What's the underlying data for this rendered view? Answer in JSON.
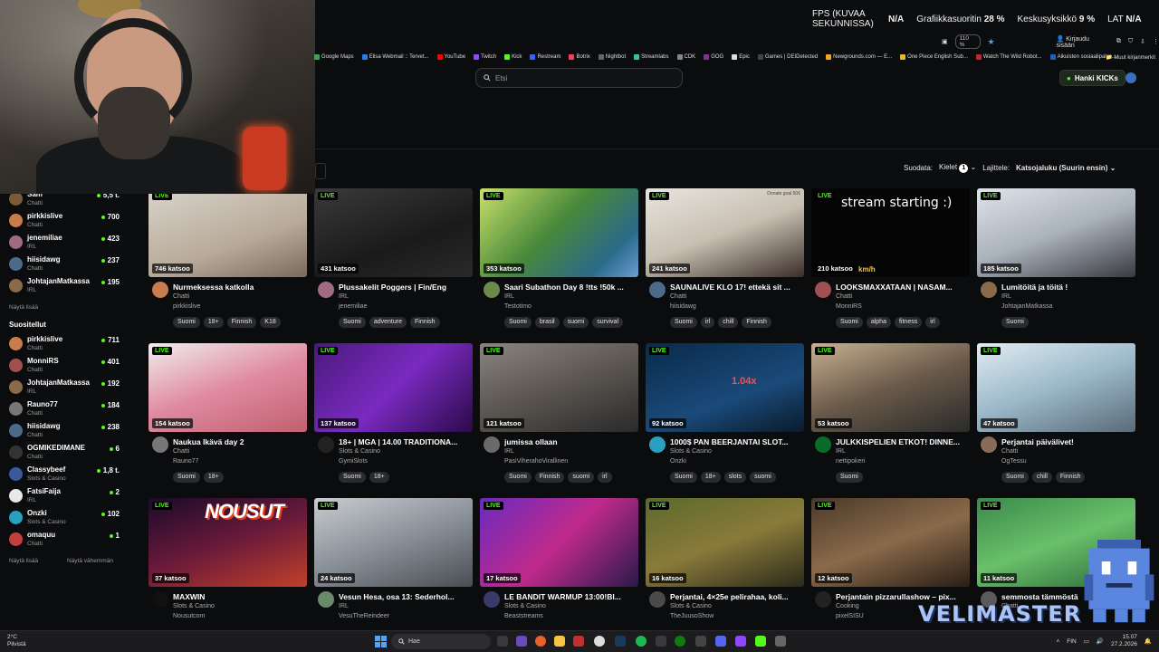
{
  "osd": {
    "fps_label": "FPS (KUVAA SEKUNNISSA)",
    "fps_value": "N/A",
    "gpu_label": "Grafiikkasuoritin",
    "gpu_value": "28 %",
    "cpu_label": "Keskusyksikkö",
    "cpu_value": "9 %",
    "lat_label": "LAT",
    "lat_value": "N/A"
  },
  "browser": {
    "zoom": "110 %",
    "login": "Kirjaudu sisään",
    "other_bookmarks": "Muut kirjanmerkit",
    "bookmarks": [
      {
        "label": "Google Maps",
        "color": "#34a853"
      },
      {
        "label": "Elisa Webmail :: Tervet...",
        "color": "#2b7de9"
      },
      {
        "label": "YouTube",
        "color": "#ff0000"
      },
      {
        "label": "Twitch",
        "color": "#9146ff"
      },
      {
        "label": "Kick",
        "color": "#53fc18"
      },
      {
        "label": "Restream",
        "color": "#3366ff"
      },
      {
        "label": "Botrix",
        "color": "#ff3b5c"
      },
      {
        "label": "Nightbot",
        "color": "#666666"
      },
      {
        "label": "Streamlabs",
        "color": "#31c3a2"
      },
      {
        "label": "CDK",
        "color": "#888888"
      },
      {
        "label": "GOG",
        "color": "#86328a"
      },
      {
        "label": "Epic",
        "color": "#dddddd"
      },
      {
        "label": "Games | DEIDetected",
        "color": "#444444"
      },
      {
        "label": "Newgrounds.com — E...",
        "color": "#f5a623"
      },
      {
        "label": "One Piece English Sub...",
        "color": "#e8b923"
      },
      {
        "label": "Watch The Wild Robot...",
        "color": "#c1272d"
      },
      {
        "label": "Aikuisten sosiaalipalve...",
        "color": "#2060c0"
      }
    ]
  },
  "header": {
    "search_placeholder": "Etsi",
    "cta": "Hanki KICKs"
  },
  "filters": {
    "filter_label": "Suodata:",
    "languages_label": "Kielet",
    "languages_count": "1",
    "sort_label": "Lajittele:",
    "sort_value": "Katsojaluku (Suurin ensin)"
  },
  "sidebar": {
    "top_items": [
      {
        "name": "Sam",
        "category": "Chatti",
        "viewers": "5,5 t.",
        "color": "#7a5a3a"
      },
      {
        "name": "pirkkislive",
        "category": "Chatti",
        "viewers": "700",
        "color": "#c97c4c"
      },
      {
        "name": "jenemiliae",
        "category": "IRL",
        "viewers": "423",
        "color": "#a06a80"
      },
      {
        "name": "hiisidawg",
        "category": "Chatti",
        "viewers": "237",
        "color": "#4c6a8a"
      },
      {
        "name": "JohtajanMatkassa",
        "category": "IRL",
        "viewers": "195",
        "color": "#8a6a4a"
      }
    ],
    "show_more": "Näytä lisää",
    "recommended_title": "Suositellut",
    "recommended": [
      {
        "name": "pirkkislive",
        "category": "Chatti",
        "viewers": "711",
        "color": "#c97c4c"
      },
      {
        "name": "MonniRS",
        "category": "Chatti",
        "viewers": "401",
        "color": "#a05050"
      },
      {
        "name": "JohtajanMatkassa",
        "category": "IRL",
        "viewers": "192",
        "color": "#8a6a4a"
      },
      {
        "name": "Rauno77",
        "category": "Chatti",
        "viewers": "184",
        "color": "#777777"
      },
      {
        "name": "hiisidawg",
        "category": "Chatti",
        "viewers": "238",
        "color": "#4c6a8a"
      },
      {
        "name": "OGMIKEDIMANE",
        "category": "Chatti",
        "viewers": "6",
        "color": "#333333"
      },
      {
        "name": "Classybeef",
        "category": "Slots & Casino",
        "viewers": "1,8 t.",
        "color": "#3a5a9a"
      },
      {
        "name": "FatsiFaija",
        "category": "IRL",
        "viewers": "2",
        "color": "#e8e8e8"
      },
      {
        "name": "Onzki",
        "category": "Slots & Casino",
        "viewers": "102",
        "color": "#2aa0c0"
      },
      {
        "name": "omaquu",
        "category": "Chatti",
        "viewers": "1",
        "color": "#c04040"
      }
    ],
    "show_more2": "Näytä lisää",
    "show_less": "Näytä vähemmän"
  },
  "live_label": "LIVE",
  "cards": [
    {
      "views": "746 katsoo",
      "title": "Nurmeksessa katkolla",
      "category": "Chatti",
      "streamer": "pirkkislive",
      "tags": [
        "Suomi",
        "18+",
        "Finnish",
        "K18"
      ],
      "bg": "linear-gradient(160deg,#d8d4cc,#b8aa98 60%,#7a6a5a)",
      "avatar": "#c97c4c"
    },
    {
      "views": "431 katsoo",
      "title": "Plussakelit Poggers | Fin/Eng",
      "category": "IRL",
      "streamer": "jenemiliae",
      "tags": [
        "Suomi",
        "adventure",
        "Finnish"
      ],
      "bg": "linear-gradient(160deg,#3a3a3a,#1a1a1a 60%,#2a2a2a)",
      "avatar": "#a06a80"
    },
    {
      "views": "353 katsoo",
      "title": "Saari Subathon Day 8 !tts !50k ...",
      "category": "IRL",
      "streamer": "Testotimo",
      "tags": [
        "Suomi",
        "brasil",
        "suomi",
        "survival"
      ],
      "bg": "linear-gradient(135deg,#c9e06a,#4a8a3a 45%,#2a6a8a 80%,#6aa0d0)",
      "avatar": "#6a8a4a"
    },
    {
      "views": "241 katsoo",
      "title": "SAUNALIVE KLO 17! ettekä sit ...",
      "category": "Chatti",
      "streamer": "hiisidawg",
      "tags": [
        "Suomi",
        "irl",
        "chill",
        "Finnish"
      ],
      "bg": "linear-gradient(160deg,#e8e4de,#c8bfb2 50%,#3a2e28)",
      "avatar": "#4c6a8a",
      "overlay": "Donate goal 50€"
    },
    {
      "views": "210 katsoo",
      "title": "LOOKSMAXXATAAN | NASAM...",
      "category": "Chatti",
      "streamer": "MonniRS",
      "tags": [
        "Suomi",
        "alpha",
        "fitness",
        "irl"
      ],
      "bg": "#050505",
      "avatar": "#a05050",
      "caption": "stream starting :)",
      "speed": "km/h"
    },
    {
      "views": "185 katsoo",
      "title": "Lumitöitä ja töitä !",
      "category": "IRL",
      "streamer": "JohtajanMatkassa",
      "tags": [
        "Suomi"
      ],
      "bg": "linear-gradient(160deg,#dfe4ea,#aab2bc 50%,#3a3a40)",
      "avatar": "#8a6a4a"
    },
    {
      "views": "154 katsoo",
      "title": "Naukua Ikävä day 2",
      "category": "Chatti",
      "streamer": "Rauno77",
      "tags": [
        "Suomi",
        "18+"
      ],
      "bg": "linear-gradient(160deg,#f0eeee,#e08aa0 50%,#c06070)",
      "avatar": "#777777"
    },
    {
      "views": "137 katsoo",
      "title": "18+ | MGA | 14.00 TRADITIONA...",
      "category": "Slots & Casino",
      "streamer": "GymiSlots",
      "tags": [
        "Suomi",
        "18+"
      ],
      "bg": "linear-gradient(135deg,#4a1a7a,#7a2ac0 50%,#2a0a4a)",
      "avatar": "#222222"
    },
    {
      "views": "121 katsoo",
      "title": "jumissa ollaan",
      "category": "IRL",
      "streamer": "PasiViherahoVirallinen",
      "tags": [
        "Suomi",
        "Finnish",
        "suomi",
        "irl"
      ],
      "bg": "linear-gradient(160deg,#8a8580,#5a5550 50%,#2a2a2a)",
      "avatar": "#6a6a6a"
    },
    {
      "views": "92 katsoo",
      "title": "1000$ PAN BEERJANTAI SLOT...",
      "category": "Slots & Casino",
      "streamer": "Onzki",
      "tags": [
        "Suomi",
        "18+",
        "slots",
        "suomi"
      ],
      "bg": "linear-gradient(160deg,#0a2a4a,#1a4a7a 60%,#0a1a2a)",
      "avatar": "#2aa0c0",
      "multiplier": "1.04x"
    },
    {
      "views": "53 katsoo",
      "title": "JULKKISPELIEN ETKOT! DINNE...",
      "category": "IRL",
      "streamer": "nettipokeri",
      "tags": [
        "Suomi"
      ],
      "bg": "linear-gradient(160deg,#c8b090,#6a5a4a 50%,#2a2a2a)",
      "avatar": "#0a6a2a"
    },
    {
      "views": "47 katsoo",
      "title": "Perjantai päivälivet!",
      "category": "Chatti",
      "streamer": "OgTessu",
      "tags": [
        "Suomi",
        "chill",
        "Finnish"
      ],
      "bg": "linear-gradient(160deg,#e0ecf2,#9ab8c8 50%,#5a6a78)",
      "avatar": "#8a6a5a"
    },
    {
      "views": "37 katsoo",
      "title": "MAXWIN",
      "category": "Slots & Casino",
      "streamer": "Nousutcom",
      "tags": [],
      "bg": "linear-gradient(160deg,#1a0a2a,#6a1a3a 50%,#c0402a)",
      "avatar": "#111111",
      "brand": "NOUSUT"
    },
    {
      "views": "24 katsoo",
      "title": "Vesun Hesa, osa 13: Sederhol...",
      "category": "IRL",
      "streamer": "VesuTheReindeer",
      "tags": [],
      "bg": "linear-gradient(160deg,#c8ccd0,#8a9098 50%,#4a4e54)",
      "avatar": "#6a8a6a"
    },
    {
      "views": "17 katsoo",
      "title": "LE BANDIT WARMUP 13:00!BI...",
      "category": "Slots & Casino",
      "streamer": "Beaststreams",
      "tags": [],
      "bg": "linear-gradient(135deg,#6a2ac0,#c02a8a 50%,#2a1a4a)",
      "avatar": "#3a3a6a"
    },
    {
      "views": "16 katsoo",
      "title": "Perjantai, 4×25e pelirahaa, koli...",
      "category": "Slots & Casino",
      "streamer": "TheJuusoShow",
      "tags": [],
      "bg": "linear-gradient(160deg,#5a6a2a,#8a7a3a 50%,#2a2a1a)",
      "avatar": "#4a4a4a"
    },
    {
      "views": "12 katsoo",
      "title": "Perjantain pizzarullashow – pix...",
      "category": "Cooking",
      "streamer": "pixelSISU",
      "tags": [],
      "bg": "linear-gradient(160deg,#4a3a2a,#8a6a4a 50%,#2a1e16)",
      "avatar": "#222222"
    },
    {
      "views": "11 katsoo",
      "title": "semmosta tämmöstä",
      "category": "Chatti",
      "streamer": "...",
      "tags": [],
      "bg": "linear-gradient(160deg,#3a8a4a,#6ac06a 50%,#2a6a3a)",
      "avatar": "#5a5a5a"
    }
  ],
  "overlay_brand": "VELIMASTER",
  "taskbar": {
    "temp": "2°C",
    "weather": "Pilvistä",
    "search": "Hae",
    "lang": "FIN",
    "time": "15.07",
    "date": "27.2.2026"
  }
}
